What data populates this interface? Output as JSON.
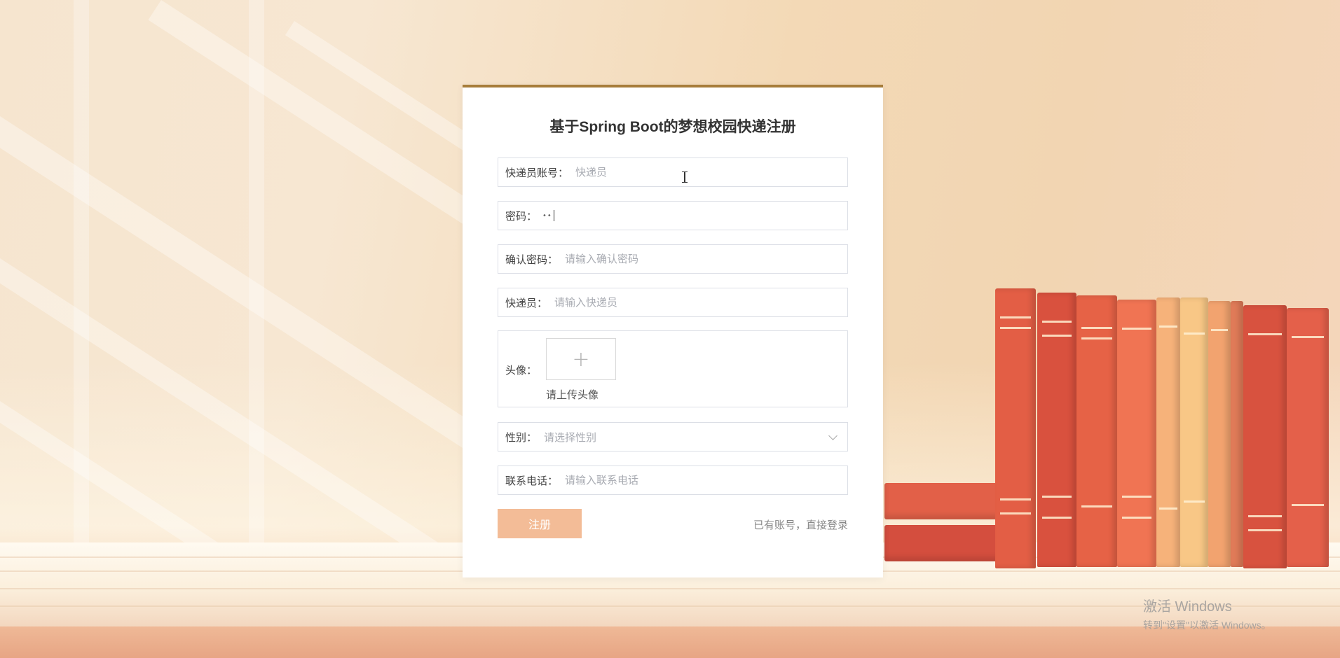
{
  "form": {
    "title": "基于Spring Boot的梦想校园快递注册",
    "account": {
      "label": "快递员账号：",
      "value": "",
      "placeholder": "快递员"
    },
    "password": {
      "label": "密码：",
      "value": "••"
    },
    "confirm_password": {
      "label": "确认密码：",
      "placeholder": "请输入确认密码"
    },
    "courier": {
      "label": "快递员：",
      "placeholder": "请输入快递员"
    },
    "avatar": {
      "label": "头像：",
      "upload_icon": "+",
      "hint": "请上传头像"
    },
    "gender": {
      "label": "性别：",
      "placeholder": "请选择性别"
    },
    "phone": {
      "label": "联系电话：",
      "placeholder": "请输入联系电话"
    },
    "register_button": "注册",
    "login_link": "已有账号，直接登录"
  },
  "watermark": {
    "title": "激活 Windows",
    "subtitle": "转到\"设置\"以激活 Windows。"
  },
  "colors": {
    "accent_border": "#a77d3a",
    "register_button": "#f3bc97"
  }
}
